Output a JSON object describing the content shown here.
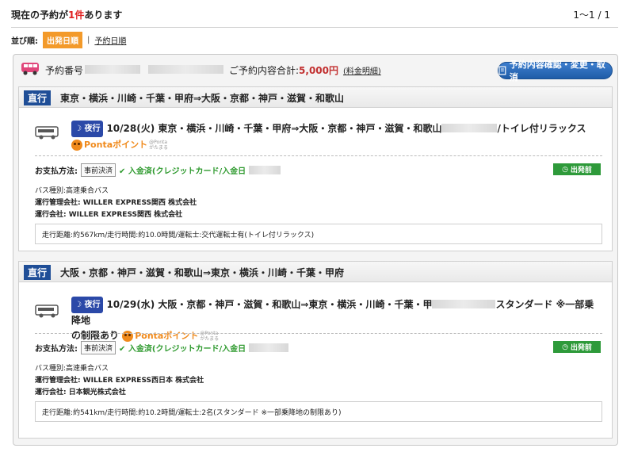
{
  "header": {
    "title_prefix": "現在の予約が",
    "title_count": "1件",
    "title_suffix": "あります",
    "pagination": "1〜1 / 1"
  },
  "sort": {
    "label": "並び順:",
    "active": "出発日順",
    "separator": "|",
    "option": "予約日順"
  },
  "reservation": {
    "number_label": "予約番号",
    "total_label": "ご予約内容合計:",
    "total_value": "5,000円",
    "detail_link": "(料金明細)",
    "confirm_button": "予約内容確認・変更・取消"
  },
  "trips": [
    {
      "badge": "直行",
      "route": "東京・横浜・川崎・千葉・甲府⇒大阪・京都・神戸・滋賀・和歌山",
      "night_badge": "夜行",
      "service_line1a": "10/28(火) 東京・横浜・川崎・千葉・甲府⇒大阪・京都・神戸・滋賀・和歌山",
      "service_line1b": "/トイレ付リラックス",
      "service_line2": "",
      "ponta": "Pontaポイント",
      "ponta_sub1": "@Ponta",
      "ponta_sub2": "がたまる",
      "pay_label": "お支払方法:",
      "pay_method": "事前決済",
      "pay_status": "✔ 入金済(クレジットカード/入金日",
      "depart_button": "出発前",
      "bus_type": "バス種別:高速乗合バス",
      "management": "運行管理会社: WILLER EXPRESS関西 株式会社",
      "operator": "運行会社: WILLER EXPRESS関西 株式会社",
      "distance": "走行距離:約567km/走行時間:約10.0時間/運転士:交代運転士有(トイレ付リラックス)"
    },
    {
      "badge": "直行",
      "route": "大阪・京都・神戸・滋賀・和歌山⇒東京・横浜・川崎・千葉・甲府",
      "night_badge": "夜行",
      "service_line1a": "10/29(水) 大阪・京都・神戸・滋賀・和歌山⇒東京・横浜・川崎・千葉・甲",
      "service_line1b": "スタンダード ※一部乗降地",
      "service_line2": "の制限あり",
      "ponta": "Pontaポイント",
      "ponta_sub1": "@Ponta",
      "ponta_sub2": "がたまる",
      "pay_label": "お支払方法:",
      "pay_method": "事前決済",
      "pay_status": "✔ 入金済(クレジットカード/入金日",
      "depart_button": "出発前",
      "bus_type": "バス種別:高速乗合バス",
      "management": "運行管理会社: WILLER EXPRESS西日本 株式会社",
      "operator": "運行会社: 日本観光株式会社",
      "distance": "走行距離:約541km/走行時間:約10.2時間/運転士:2名(スタンダード ※一部乗降地の制限あり)"
    }
  ],
  "colors": {
    "sort_active": "#f39a2a",
    "badge_blue": "#1f4e97",
    "depart_green": "#2e9a3a",
    "ponta_orange": "#f08a1c",
    "count_red": "#e02020"
  }
}
